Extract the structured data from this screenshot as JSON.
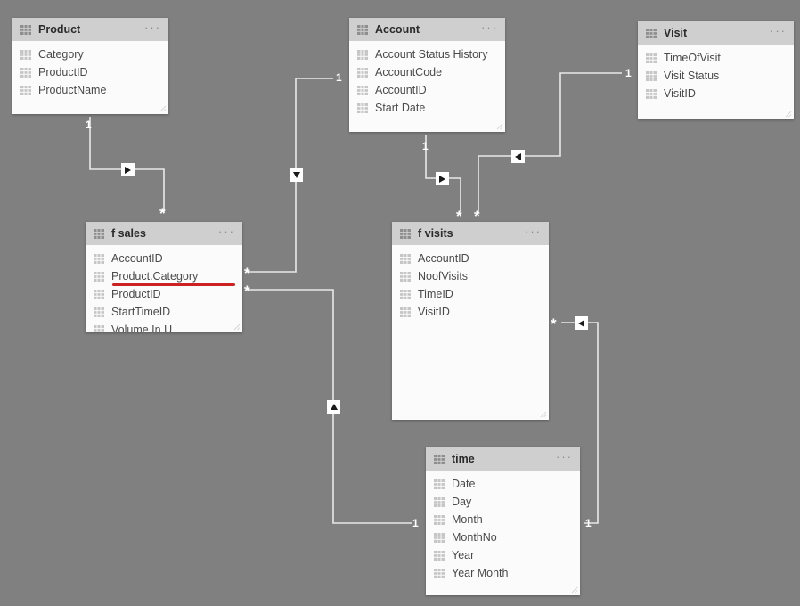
{
  "canvas": {
    "background_color": "#808080",
    "line_color": "#e8e8e8",
    "highlight_color": "#cc2222",
    "header_color": "#cfcfcf",
    "card_color": "#fbfbfb"
  },
  "tables": [
    {
      "id": "product",
      "title": "Product",
      "menu": "···",
      "fields": [
        {
          "label": "Category",
          "highlighted": false
        },
        {
          "label": "ProductID",
          "highlighted": false
        },
        {
          "label": "ProductName",
          "highlighted": false
        }
      ]
    },
    {
      "id": "account",
      "title": "Account",
      "menu": "···",
      "fields": [
        {
          "label": "Account Status History",
          "highlighted": false
        },
        {
          "label": "AccountCode",
          "highlighted": false
        },
        {
          "label": "AccountID",
          "highlighted": false
        },
        {
          "label": "Start Date",
          "highlighted": false
        }
      ]
    },
    {
      "id": "visit",
      "title": "Visit",
      "menu": "···",
      "fields": [
        {
          "label": "TimeOfVisit",
          "highlighted": false
        },
        {
          "label": "Visit Status",
          "highlighted": false
        },
        {
          "label": "VisitID",
          "highlighted": false
        }
      ]
    },
    {
      "id": "fsales",
      "title": "f sales",
      "menu": "···",
      "fields": [
        {
          "label": "AccountID",
          "highlighted": false
        },
        {
          "label": "Product.Category",
          "highlighted": true
        },
        {
          "label": "ProductID",
          "highlighted": false
        },
        {
          "label": "StartTimeID",
          "highlighted": false
        },
        {
          "label": "Volume In U",
          "highlighted": false
        }
      ]
    },
    {
      "id": "fvisits",
      "title": "f visits",
      "menu": "···",
      "fields": [
        {
          "label": "AccountID",
          "highlighted": false
        },
        {
          "label": "NoofVisits",
          "highlighted": false
        },
        {
          "label": "TimeID",
          "highlighted": false
        },
        {
          "label": "VisitID",
          "highlighted": false
        }
      ]
    },
    {
      "id": "time",
      "title": "time",
      "menu": "···",
      "fields": [
        {
          "label": "Date",
          "highlighted": false
        },
        {
          "label": "Day",
          "highlighted": false
        },
        {
          "label": "Month",
          "highlighted": false
        },
        {
          "label": "MonthNo",
          "highlighted": false
        },
        {
          "label": "Year",
          "highlighted": false
        },
        {
          "label": "Year Month",
          "highlighted": false
        }
      ]
    }
  ],
  "relationships": [
    {
      "id": "product-fsales",
      "from": "Product",
      "to": "f sales",
      "from_cardinality": "1",
      "to_cardinality": "*",
      "direction": "right"
    },
    {
      "id": "account-fsales",
      "from": "Account",
      "to": "f sales",
      "from_cardinality": "1",
      "to_cardinality": "*",
      "direction": "down"
    },
    {
      "id": "account-fvisits",
      "from": "Account",
      "to": "f visits",
      "from_cardinality": "1",
      "to_cardinality": "*",
      "direction": "right"
    },
    {
      "id": "visit-fvisits",
      "from": "Visit",
      "to": "f visits",
      "from_cardinality": "1",
      "to_cardinality": "*",
      "direction": "left"
    },
    {
      "id": "fsales-time",
      "from": "f sales",
      "to": "time",
      "from_cardinality": "*",
      "to_cardinality": "1",
      "direction": "up"
    },
    {
      "id": "fvisits-time",
      "from": "f visits",
      "to": "time",
      "from_cardinality": "*",
      "to_cardinality": "1",
      "direction": "left"
    }
  ],
  "cardinality_markers": [
    {
      "id": "m-product-one",
      "text": "1"
    },
    {
      "id": "m-fsales-prod-many",
      "text": "*"
    },
    {
      "id": "m-account-one",
      "text": "1"
    },
    {
      "id": "m-fsales-acc-many",
      "text": "*"
    },
    {
      "id": "m-fsales-time-many",
      "text": "*"
    },
    {
      "id": "m-account2-one",
      "text": "1"
    },
    {
      "id": "m-fvisits-acc-many",
      "text": "*"
    },
    {
      "id": "m-fvisits-vis-many",
      "text": "*"
    },
    {
      "id": "m-visit-one",
      "text": "1"
    },
    {
      "id": "m-time-sales-one",
      "text": "1"
    },
    {
      "id": "m-fvisits-tm-many",
      "text": "*"
    },
    {
      "id": "m-time-visits-one",
      "text": "1"
    }
  ]
}
